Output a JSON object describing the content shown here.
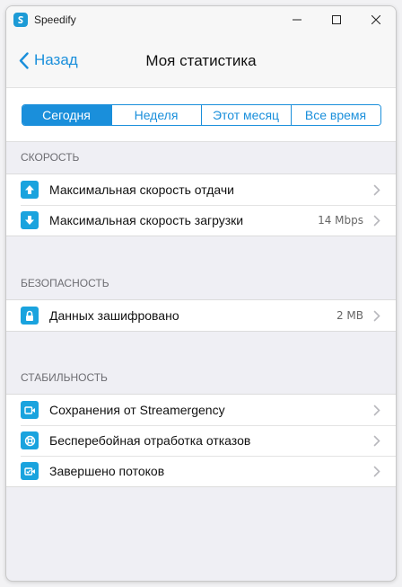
{
  "app": {
    "title": "Speedify"
  },
  "nav": {
    "back_label": "Назад",
    "title": "Моя статистика"
  },
  "segments": [
    {
      "label": "Сегодня",
      "active": true
    },
    {
      "label": "Неделя",
      "active": false
    },
    {
      "label": "Этот месяц",
      "active": false
    },
    {
      "label": "Все время",
      "active": false
    }
  ],
  "sections": {
    "speed": {
      "header": "СКОРОСТЬ",
      "rows": [
        {
          "label": "Максимальная скорость отдачи",
          "value": "",
          "icon": "upload-arrow-icon"
        },
        {
          "label": "Максимальная скорость загрузки",
          "value": "14 Mbps",
          "icon": "download-arrow-icon"
        }
      ]
    },
    "security": {
      "header": "БЕЗОПАСНОСТЬ",
      "rows": [
        {
          "label": "Данных зашифровано",
          "value": "2 MB",
          "icon": "lock-icon"
        }
      ]
    },
    "stability": {
      "header": "СТАБИЛЬНОСТЬ",
      "rows": [
        {
          "label": "Сохранения от Streamergency",
          "value": "",
          "icon": "video-camera-icon"
        },
        {
          "label": "Бесперебойная отработка отказов",
          "value": "",
          "icon": "lifebuoy-icon"
        },
        {
          "label": "Завершено потоков",
          "value": "",
          "icon": "stream-complete-icon"
        }
      ]
    }
  },
  "colors": {
    "accent": "#1a8fdb",
    "icon_bg": "#1aa3de",
    "background": "#efeff4"
  }
}
